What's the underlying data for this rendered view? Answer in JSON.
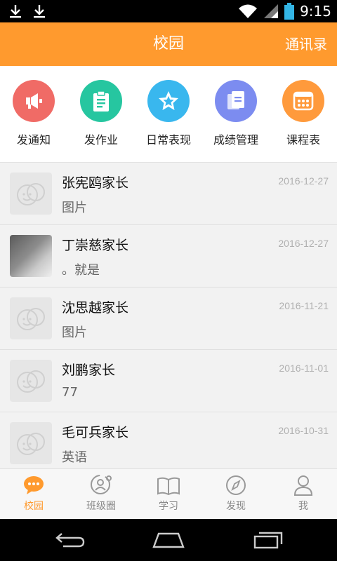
{
  "status_bar": {
    "time": "9:15",
    "icons": [
      "download-icon",
      "download-icon",
      "wifi-icon",
      "signal-icon",
      "battery-icon"
    ]
  },
  "header": {
    "title": "校园",
    "contacts_label": "通讯录"
  },
  "actions": [
    {
      "label": "发通知",
      "icon": "megaphone-icon",
      "color": "#f06b66"
    },
    {
      "label": "发作业",
      "icon": "clipboard-icon",
      "color": "#26c6a0"
    },
    {
      "label": "日常表现",
      "icon": "star-icon",
      "color": "#39b7ee"
    },
    {
      "label": "成绩管理",
      "icon": "document-icon",
      "color": "#7c8cf0"
    },
    {
      "label": "课程表",
      "icon": "calendar-grid-icon",
      "color": "#ff9a3c"
    }
  ],
  "messages": [
    {
      "name": "张宪鸥家长",
      "preview": "图片",
      "date": "2016-12-27",
      "avatar": "default-face-icon"
    },
    {
      "name": "丁崇慈家长",
      "preview": "。就是",
      "date": "2016-12-27",
      "avatar": "photo"
    },
    {
      "name": "沈思越家长",
      "preview": "图片",
      "date": "2016-11-21",
      "avatar": "default-face-icon"
    },
    {
      "name": "刘鹏家长",
      "preview": "77",
      "date": "2016-11-01",
      "avatar": "default-face-icon"
    },
    {
      "name": "毛可兵家长",
      "preview": "英语",
      "date": "2016-10-31",
      "avatar": "default-face-icon"
    }
  ],
  "tabs": [
    {
      "label": "校园",
      "icon": "chat-bubble-icon",
      "active": true
    },
    {
      "label": "班级圈",
      "icon": "class-circle-icon",
      "active": false
    },
    {
      "label": "学习",
      "icon": "book-icon",
      "active": false
    },
    {
      "label": "发现",
      "icon": "compass-icon",
      "active": false
    },
    {
      "label": "我",
      "icon": "person-icon",
      "active": false
    }
  ],
  "colors": {
    "accent": "#ff9a2e",
    "tab_inactive": "#888888"
  }
}
